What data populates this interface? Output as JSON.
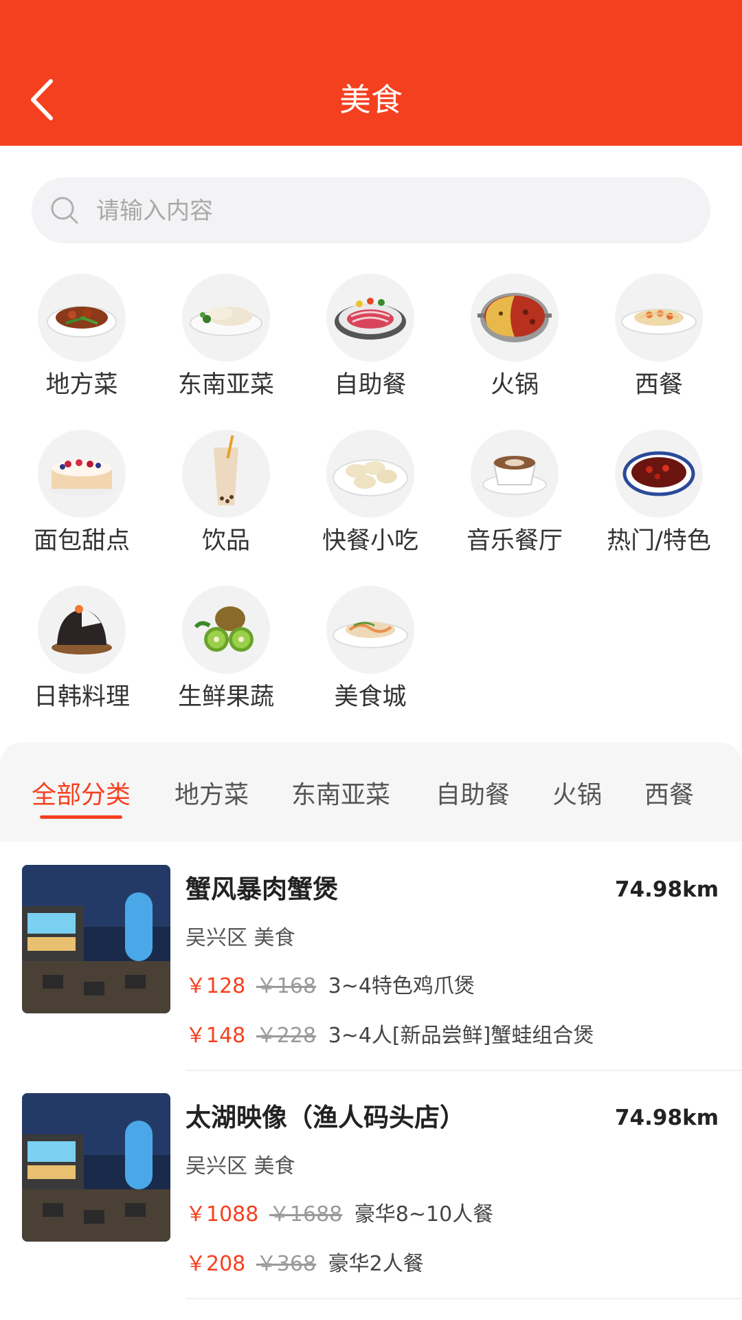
{
  "header": {
    "title": "美食",
    "background": "#f5401f",
    "back_icon": "chevron-left-icon"
  },
  "search": {
    "placeholder": "请输入内容",
    "value": "",
    "icon": "search-icon"
  },
  "categories": [
    {
      "label": "地方菜",
      "icon": "stir-fry-dish-icon"
    },
    {
      "label": "东南亚菜",
      "icon": "chicken-dish-icon"
    },
    {
      "label": "自助餐",
      "icon": "buffet-platter-icon"
    },
    {
      "label": "火锅",
      "icon": "hotpot-icon"
    },
    {
      "label": "西餐",
      "icon": "pasta-icon"
    },
    {
      "label": "面包甜点",
      "icon": "cake-icon"
    },
    {
      "label": "饮品",
      "icon": "milk-tea-icon"
    },
    {
      "label": "快餐小吃",
      "icon": "dumplings-icon"
    },
    {
      "label": "音乐餐厅",
      "icon": "coffee-cup-icon"
    },
    {
      "label": "热门/特色",
      "icon": "spicy-dish-icon"
    },
    {
      "label": "日韩料理",
      "icon": "rice-ball-icon"
    },
    {
      "label": "生鲜果蔬",
      "icon": "kiwi-fruit-icon"
    },
    {
      "label": "美食城",
      "icon": "noodle-dish-icon"
    }
  ],
  "tabs": [
    {
      "label": "全部分类",
      "active": true
    },
    {
      "label": "地方菜",
      "active": false
    },
    {
      "label": "东南亚菜",
      "active": false
    },
    {
      "label": "自助餐",
      "active": false
    },
    {
      "label": "火锅",
      "active": false
    },
    {
      "label": "西餐",
      "active": false
    }
  ],
  "shops": [
    {
      "name": "蟹风暴肉蟹煲",
      "distance": "74.98km",
      "meta": "吴兴区  美食",
      "deals": [
        {
          "price": "￥128",
          "original": "￥168",
          "desc": "3~4特色鸡爪煲"
        },
        {
          "price": "￥148",
          "original": "￥228",
          "desc": "3~4人[新品尝鲜]蟹蛙组合煲"
        }
      ]
    },
    {
      "name": "太湖映像（渔人码头店）",
      "distance": "74.98km",
      "meta": "吴兴区  美食",
      "deals": [
        {
          "price": "￥1088",
          "original": "￥1688",
          "desc": "豪华8~10人餐"
        },
        {
          "price": "￥208",
          "original": "￥368",
          "desc": "豪华2人餐"
        }
      ]
    }
  ],
  "colors": {
    "accent": "#f5401f",
    "tab_bar_bg": "#f6f6f6",
    "search_bg": "#f3f3f5"
  }
}
